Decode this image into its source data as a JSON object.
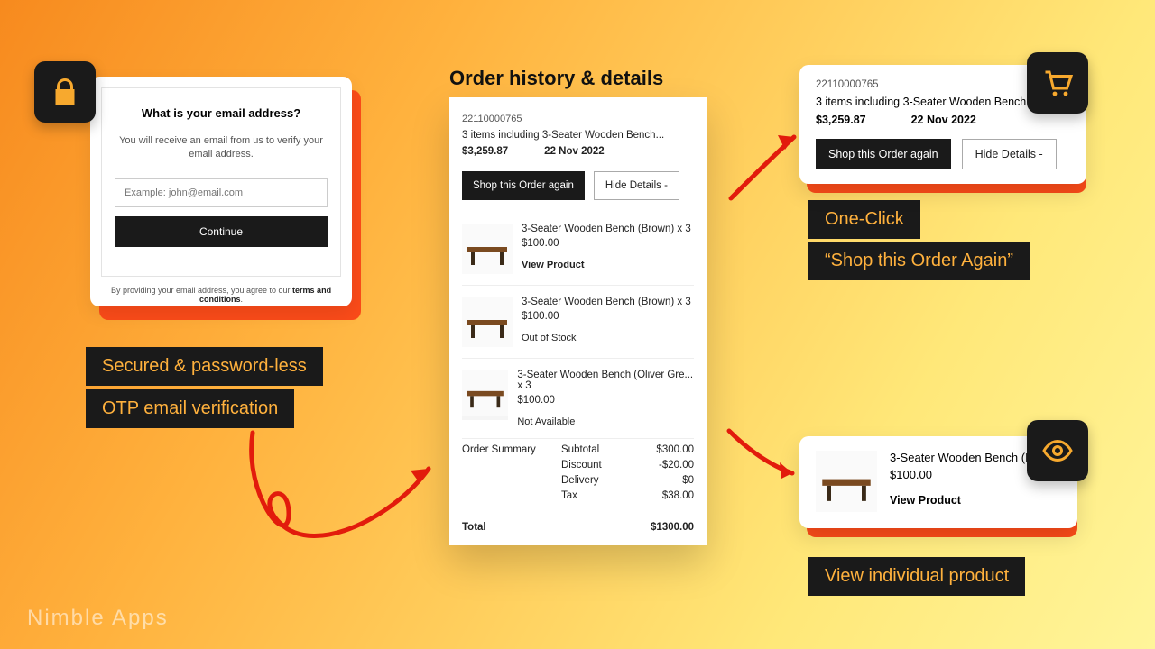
{
  "email_card": {
    "heading": "What is your email address?",
    "sub": "You will receive an email from us to verify your email address.",
    "placeholder": "Example: john@email.com",
    "continue": "Continue",
    "terms_pre": "By providing your email address, you agree to our ",
    "terms_link": "terms and conditions"
  },
  "callouts": {
    "a1": "Secured & password-less",
    "a2": "OTP email verification",
    "b1": "One-Click",
    "b2": "“Shop this Order Again”",
    "c": "View individual product"
  },
  "center": {
    "title": "Order history & details",
    "order_id": "22110000765",
    "summary_line": "3 items including 3-Seater Wooden Bench...",
    "total": "$3,259.87",
    "date": "22 Nov 2022",
    "shop_again": "Shop this Order again",
    "hide_details": "Hide Details  -",
    "items": [
      {
        "name": "3-Seater Wooden Bench (Brown) x 3",
        "price": "$100.00",
        "action": "View Product"
      },
      {
        "name": "3-Seater Wooden Bench (Brown) x 3",
        "price": "$100.00",
        "action": "Out of Stock"
      },
      {
        "name": "3-Seater Wooden Bench (Oliver Gre... x 3",
        "price": "$100.00",
        "action": "Not Available"
      }
    ],
    "summary_label": "Order Summary",
    "rows": [
      {
        "k": "Subtotal",
        "v": "$300.00"
      },
      {
        "k": "Discount",
        "v": "-$20.00"
      },
      {
        "k": "Delivery",
        "v": "$0"
      },
      {
        "k": "Tax",
        "v": "$38.00"
      }
    ],
    "grand_k": "Total",
    "grand_v": "$1300.00"
  },
  "mini1": {
    "order_id": "22110000765",
    "line2": "3 items including 3-Seater Wooden Bench...",
    "total": "$3,259.87",
    "date": "22 Nov 2022",
    "shop": "Shop this Order again",
    "hide": "Hide Details  -"
  },
  "mini2": {
    "name": "3-Seater Wooden Bench (Br...",
    "price": "$100.00",
    "view": "View Product"
  },
  "brand": "Nimble Apps"
}
